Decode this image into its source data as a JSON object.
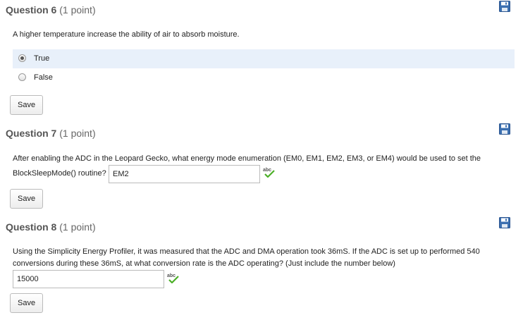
{
  "q6": {
    "title": "Question 6",
    "points": "(1 point)",
    "text": "A higher temperature increase the ability of air to absorb moisture.",
    "choices": [
      {
        "label": "True",
        "selected": true
      },
      {
        "label": "False",
        "selected": false
      }
    ],
    "save_label": "Save"
  },
  "q7": {
    "title": "Question 7",
    "points": "(1 point)",
    "text_line1": "After enabling the ADC in the Leopard Gecko, what energy mode enumeration (EM0, EM1, EM2, EM3, or EM4) would be used to set the",
    "text_line2": "BlockSleepMode() routine?",
    "answer": "EM2",
    "save_label": "Save"
  },
  "q8": {
    "title": "Question 8",
    "points": "(1 point)",
    "text_line1": "Using the Simplicity Energy Profiler, it was measured that the ADC and DMA operation took 36mS.  If the ADC is set up to performed 540",
    "text_line2": "conversions during these 36mS, at what conversion rate is the ADC operating? (Just include the number below)",
    "answer": "15000",
    "save_label": "Save"
  },
  "spellcheck_text": "abc",
  "icons": {
    "save": "floppy-disk-icon",
    "spellcheck": "spellcheck-icon"
  },
  "colors": {
    "selected_bg": "#e8f0fa",
    "floppy": "#3b6fb0",
    "check": "#4caf28"
  }
}
